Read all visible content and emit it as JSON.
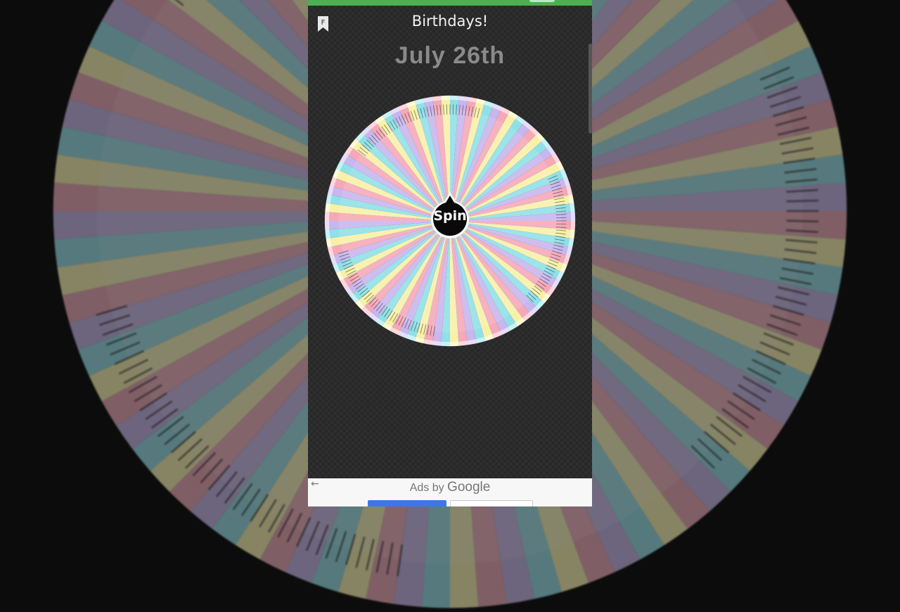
{
  "app": {
    "title": "Birthdays!",
    "date_heading": "July 26th",
    "status_bar_color": "#4caf50"
  },
  "toolbar": {
    "bookmark_icon": "bookmark-icon",
    "bookmark_letter": "F"
  },
  "wheel": {
    "segment_colors": [
      "#f5a8b8",
      "#f7f1a8",
      "#8fe0e8",
      "#c8b6ee"
    ],
    "spin_label": "Spin"
  },
  "ad_bar": {
    "back_icon": "arrow-left-icon",
    "label_prefix": "Ads by",
    "label_brand": "Google"
  }
}
